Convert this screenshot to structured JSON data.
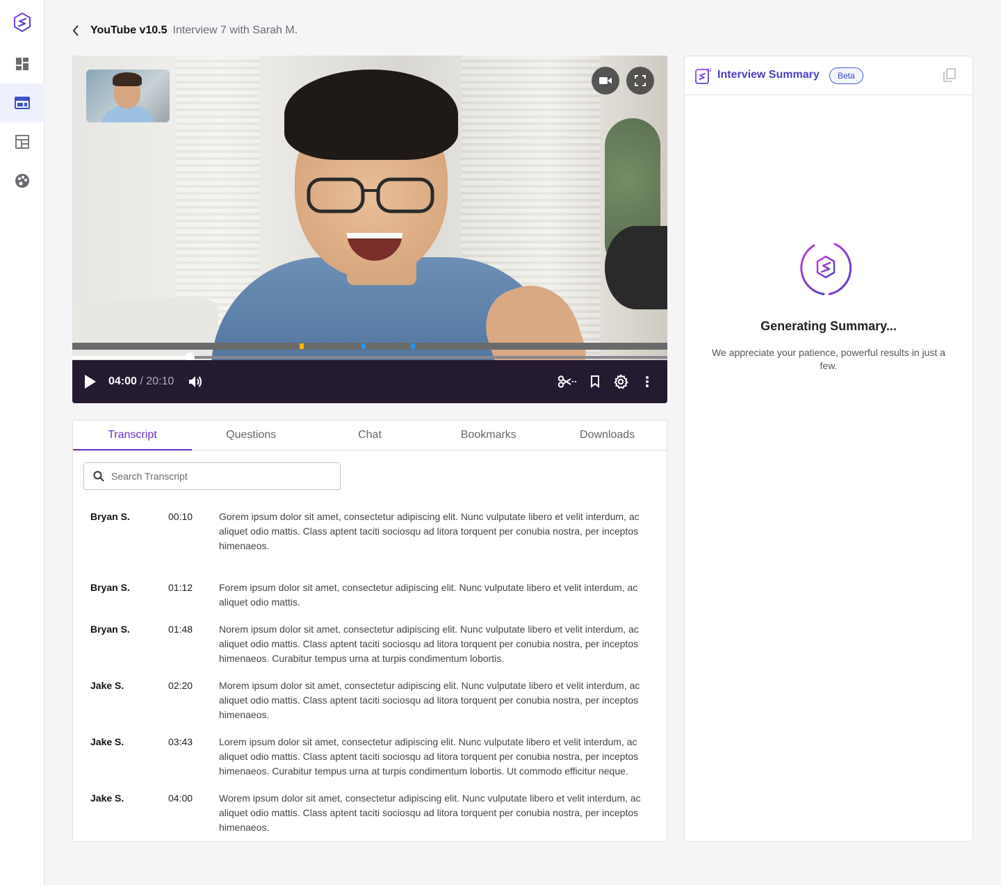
{
  "header": {
    "title": "YouTube v10.5",
    "subtitle": "Interview 7 with Sarah M."
  },
  "sidebar": {
    "items": [
      {
        "icon": "dashboard-icon",
        "active": false
      },
      {
        "icon": "layout-icon",
        "active": true
      },
      {
        "icon": "table-icon",
        "active": false
      },
      {
        "icon": "palette-icon",
        "active": false
      }
    ]
  },
  "player": {
    "current_time": "04:00",
    "separator": " / ",
    "duration": "20:10",
    "progress": 0.198,
    "markers": [
      {
        "position": 0.386,
        "color": "#f5b800"
      },
      {
        "position": 0.49,
        "color": "#2196f3"
      },
      {
        "position": 0.572,
        "color": "#2196f3"
      }
    ]
  },
  "tabs": [
    "Transcript",
    "Questions",
    "Chat",
    "Bookmarks",
    "Downloads"
  ],
  "search": {
    "placeholder": "Search Transcript"
  },
  "transcript": [
    {
      "speaker": "Bryan S.",
      "time": "00:10",
      "text": "Gorem ipsum dolor sit amet, consectetur adipiscing elit. Nunc vulputate libero et velit interdum, ac aliquet odio mattis. Class aptent taciti sociosqu ad litora torquent per conubia nostra, per inceptos himenaeos."
    },
    {
      "speaker": "Bryan S.",
      "time": "01:12",
      "text": "Forem ipsum dolor sit amet, consectetur adipiscing elit. Nunc vulputate libero et velit interdum, ac aliquet odio mattis."
    },
    {
      "speaker": "Bryan S.",
      "time": "01:48",
      "text": "Norem ipsum dolor sit amet, consectetur adipiscing elit. Nunc vulputate libero et velit interdum, ac aliquet odio mattis. Class aptent taciti sociosqu ad litora torquent per conubia nostra, per inceptos himenaeos. Curabitur tempus urna at turpis condimentum lobortis."
    },
    {
      "speaker": "Jake S.",
      "time": "02:20",
      "text": "Morem ipsum dolor sit amet, consectetur adipiscing elit. Nunc vulputate libero et velit interdum, ac aliquet odio mattis. Class aptent taciti sociosqu ad litora torquent per conubia nostra, per inceptos himenaeos."
    },
    {
      "speaker": "Jake S.",
      "time": "03:43",
      "text": "Lorem ipsum dolor sit amet, consectetur adipiscing elit. Nunc vulputate libero et velit interdum, ac aliquet odio mattis. Class aptent taciti sociosqu ad litora torquent per conubia nostra, per inceptos himenaeos. Curabitur tempus urna at turpis condimentum lobortis. Ut commodo efficitur neque."
    },
    {
      "speaker": "Jake S.",
      "time": "04:00",
      "text": "Worem ipsum dolor sit amet, consectetur adipiscing elit. Nunc vulputate libero et velit interdum, ac aliquet odio mattis. Class aptent taciti sociosqu ad litora torquent per conubia nostra, per inceptos himenaeos."
    }
  ],
  "summary": {
    "ai_badge": "AI",
    "title": "Interview Summary",
    "beta_label": "Beta",
    "generating_title": "Generating Summary...",
    "generating_text": "We appreciate your patience, powerful results in just a few."
  },
  "colors": {
    "accent": "#6a2fc4",
    "summary_title": "#4a3fc2",
    "control_bar": "#241b31"
  }
}
